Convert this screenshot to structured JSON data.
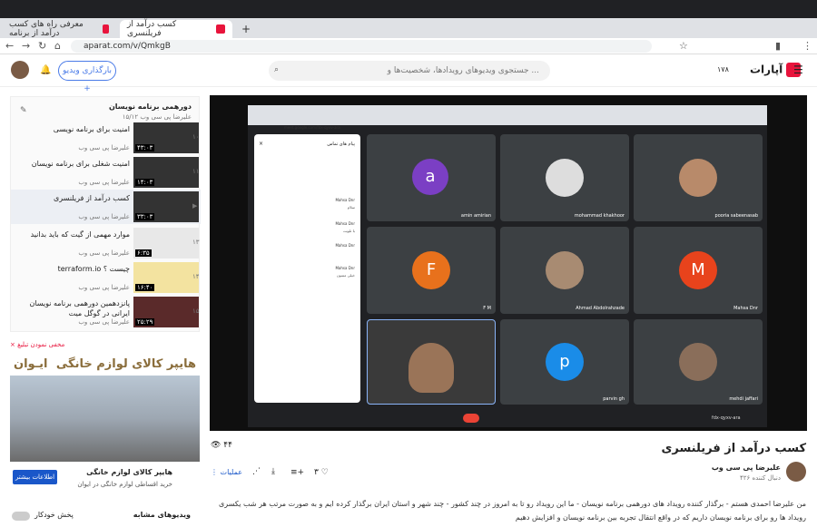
{
  "browser": {
    "tabs": [
      {
        "label": "معرفی راه های کسب درآمد از برنامه"
      },
      {
        "label": "کسب درآمد از فریلنسری"
      }
    ],
    "url": "aparat.com/v/QmkgB"
  },
  "header": {
    "search_placeholder": "جستجوی ویدیوهای رویدادها، شخصیت‌ها و ...",
    "upload_label": "بارگذاری ویدیو",
    "logo": "آپارات",
    "badge": "۱۷۸"
  },
  "meet": {
    "url": "meet.google.com/fdx-qyxv-ara",
    "chat_title": "پیام های تماس",
    "chat_senders": [
      "Mahsa Dnr",
      "Mahsa Dnr",
      "Mahsa Dnr",
      "Mahsa Dnr"
    ],
    "chat_lines": [
      "سلام",
      "با تلویت",
      "خیلی ممنون"
    ],
    "meeting_code": "fdx-qyxv-ara",
    "participants": [
      {
        "name": "amin amirian",
        "letter": "a",
        "color": "#7b3fc4"
      },
      {
        "name": "mohammad khakhoor",
        "letter": "",
        "color": ""
      },
      {
        "name": "pooria sabeenasab",
        "letter": "",
        "color": ""
      },
      {
        "name": "F M",
        "letter": "F",
        "color": "#e8711c"
      },
      {
        "name": "Ahmad Abdolrahzade",
        "letter": "",
        "color": ""
      },
      {
        "name": "Mahsa Dnr",
        "letter": "M",
        "color": "#e8431c"
      },
      {
        "name": "",
        "letter": "",
        "color": ""
      },
      {
        "name": "parvin gh",
        "letter": "p",
        "color": "#1a8ce8"
      },
      {
        "name": "mehdi jaffari",
        "letter": "",
        "color": ""
      }
    ]
  },
  "playlist": {
    "title": "دورهمی برنامه نویسان",
    "subtitle": "علیرضا پی سی وب ۱۵/۱۲",
    "items": [
      {
        "title": "امنیت برای برنامه نویسی",
        "channel": "علیرضا پی سی وب",
        "duration": "۴۳:۰۳",
        "num": "۱۰"
      },
      {
        "title": "امنیت شغلی برای برنامه نویسان",
        "channel": "علیرضا پی سی وب",
        "duration": "۱۴:۰۳",
        "num": "۱۱"
      },
      {
        "title": "کسب درآمد از فریلنسری",
        "channel": "علیرضا پی سی وب",
        "duration": "۳۳:۰۳",
        "num": "▶"
      },
      {
        "title": "موارد مهمی از گیت که باید بدانید",
        "channel": "علیرضا پی سی وب",
        "duration": "۶:۳۵",
        "num": "۱۳"
      },
      {
        "title": "terraform.io چیست ؟",
        "channel": "علیرضا پی سی وب",
        "duration": "۱۶:۴۰",
        "num": "۱۴"
      },
      {
        "title": "پانزدهمین دورهمی برنامه نویسان ایرانی در گوگل میت",
        "channel": "علیرضا پی سی وب",
        "duration": "۲۵:۲۹",
        "num": "۱۵"
      }
    ]
  },
  "ad": {
    "label": "مخفی نمودن تبلیغ",
    "banner": "هایپر کالای لوازم خانگی",
    "brand": "ایـوان",
    "title": "هایپر کالای لوازم خانگی",
    "desc": "خرید اقساطی لوازم خانگی در ایوان",
    "cta": "اطلاعات بیشتر"
  },
  "footer": {
    "similar": "ویدیوهای مشابه",
    "autoplay": "پخش خودکار"
  },
  "video": {
    "title": "کسب درآمد از فریلنسری",
    "views": "۴۴",
    "channel": "علیرضا پی سی وب",
    "followers": "۴۲۶ دنبال کننده",
    "likes": "۳",
    "actions": "عملیات",
    "description": "من علیرضا احمدی هستم - برگذار کننده رویداد های دورهمی برنامه نویسان - ما این رویداد رو تا به امروز در چند کشور - چند شهر و استان ایران برگذار کرده ایم و به صورت مرتب هر شب یکسری رویداد ها رو برای برنامه نویسان داریم که در واقع انتقال تجربه بین برنامه نویسان و افزایش دهیم"
  }
}
